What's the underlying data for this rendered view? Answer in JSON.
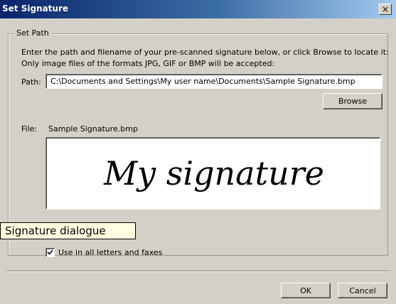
{
  "window": {
    "title": "Set Signature",
    "close_label": "×"
  },
  "group": {
    "legend": "Set Path",
    "instructions_line1": "Enter the path and filename of your pre-scanned signature below, or click Browse to locate it:",
    "instructions_line2": "Only image files of the formats JPG, GIF or BMP will be accepted:"
  },
  "path": {
    "label": "Path:",
    "value": "C:\\Documents and Settings\\My user name\\Documents\\Sample Signature.bmp"
  },
  "browse_label": "Browse",
  "file": {
    "label": "File:",
    "name": "Sample Signature.bmp"
  },
  "preview": {
    "signature_text": "My signature"
  },
  "tooltip": {
    "text": "Signature dialogue"
  },
  "use_all": {
    "label": "Use in all letters and faxes",
    "checked": true
  },
  "footer": {
    "ok_label": "OK",
    "cancel_label": "Cancel"
  }
}
